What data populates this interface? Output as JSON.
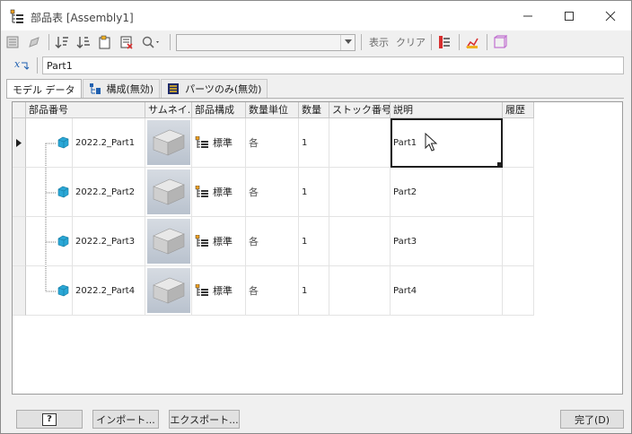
{
  "window": {
    "title": "部品表 [Assembly1]",
    "app_icon": "bom-icon"
  },
  "toolbar": {
    "combo_value": "",
    "show_label": "表示",
    "clear_label": "クリア",
    "icons": [
      "bom-view-icon",
      "edit-icon",
      "sort-ascending-icon",
      "sort-descending-icon",
      "export-icon",
      "filter-icon",
      "search-icon",
      "highlight-icon",
      "settings-icon",
      "part-icon"
    ]
  },
  "formula": {
    "value": "Part1"
  },
  "tabs": [
    {
      "label": "モデル データ",
      "active": true
    },
    {
      "label": "構成(無効)",
      "active": false
    },
    {
      "label": "パーツのみ(無効)",
      "active": false
    }
  ],
  "columns": [
    "",
    "部品番号",
    "サムネイ...",
    "部品構成",
    "数量単位",
    "数量",
    "ストック番号",
    "説明",
    "履歴"
  ],
  "rows": [
    {
      "part_number": "2022.2_Part1",
      "structure": "標準",
      "unit": "各",
      "qty": "1",
      "stock": "",
      "desc": "Part1",
      "history": ""
    },
    {
      "part_number": "2022.2_Part2",
      "structure": "標準",
      "unit": "各",
      "qty": "1",
      "stock": "",
      "desc": "Part2",
      "history": ""
    },
    {
      "part_number": "2022.2_Part3",
      "structure": "標準",
      "unit": "各",
      "qty": "1",
      "stock": "",
      "desc": "Part3",
      "history": ""
    },
    {
      "part_number": "2022.2_Part4",
      "structure": "標準",
      "unit": "各",
      "qty": "1",
      "stock": "",
      "desc": "Part4",
      "history": ""
    }
  ],
  "buttons": {
    "help": "?",
    "import": "インポート...",
    "export": "エクスポート...",
    "done": "完了(D)"
  },
  "colors": {
    "part_icon": "#2aa7d6",
    "accent_red": "#d83030"
  }
}
